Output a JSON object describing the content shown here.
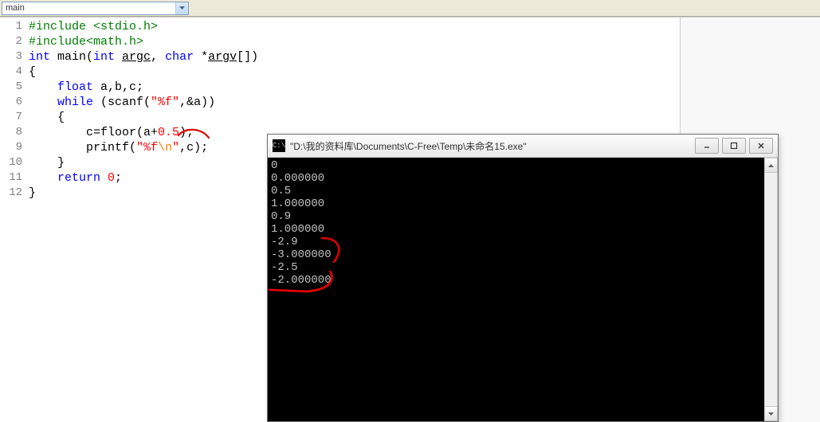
{
  "toolbar": {
    "dropdown_value": "main",
    "secondary_label": ""
  },
  "code": {
    "lines": [
      {
        "no": 1,
        "tokens": [
          [
            "inc",
            "#include <stdio.h>"
          ]
        ]
      },
      {
        "no": 2,
        "tokens": [
          [
            "inc",
            "#include<math.h>"
          ]
        ]
      },
      {
        "no": 3,
        "tokens": [
          [
            "type",
            "int "
          ],
          [
            "ident",
            "main("
          ],
          [
            "type",
            "int "
          ],
          [
            "ident_u",
            "argc"
          ],
          [
            "ident",
            ", "
          ],
          [
            "type",
            "char "
          ],
          [
            "ident",
            "*"
          ],
          [
            "ident_u",
            "argv"
          ],
          [
            "ident",
            "[])"
          ]
        ]
      },
      {
        "no": 4,
        "tokens": [
          [
            "ident",
            "{"
          ]
        ]
      },
      {
        "no": 5,
        "tokens": [
          [
            "ident",
            "    "
          ],
          [
            "type",
            "float "
          ],
          [
            "ident",
            "a,b,c;"
          ]
        ]
      },
      {
        "no": 6,
        "tokens": [
          [
            "ident",
            "    "
          ],
          [
            "type",
            "while "
          ],
          [
            "ident",
            "(scanf("
          ],
          [
            "str",
            "\"%f\""
          ],
          [
            "ident",
            ",&a))"
          ]
        ]
      },
      {
        "no": 7,
        "tokens": [
          [
            "ident",
            "    {"
          ]
        ]
      },
      {
        "no": 8,
        "tokens": [
          [
            "ident",
            "        c=floor(a+"
          ],
          [
            "num",
            "0.5"
          ],
          [
            "ident",
            ");"
          ]
        ]
      },
      {
        "no": 9,
        "tokens": [
          [
            "ident",
            "        printf("
          ],
          [
            "str",
            "\"%f"
          ],
          [
            "fmt",
            "\\n"
          ],
          [
            "str",
            "\""
          ],
          [
            "ident",
            ",c);"
          ]
        ]
      },
      {
        "no": 10,
        "tokens": [
          [
            "ident",
            "    }"
          ]
        ]
      },
      {
        "no": 11,
        "tokens": [
          [
            "ident",
            "    "
          ],
          [
            "type",
            "return "
          ],
          [
            "num",
            "0"
          ],
          [
            "ident",
            ";"
          ]
        ]
      },
      {
        "no": 12,
        "tokens": [
          [
            "ident",
            "}"
          ]
        ]
      }
    ]
  },
  "console": {
    "title": "\"D:\\我的资料库\\Documents\\C-Free\\Temp\\未命名15.exe\"",
    "lines": [
      "0",
      "0.000000",
      "0.5",
      "1.000000",
      "0.9",
      "1.000000",
      "-2.9",
      "-3.000000",
      "-2.5",
      "-2.000000"
    ]
  }
}
